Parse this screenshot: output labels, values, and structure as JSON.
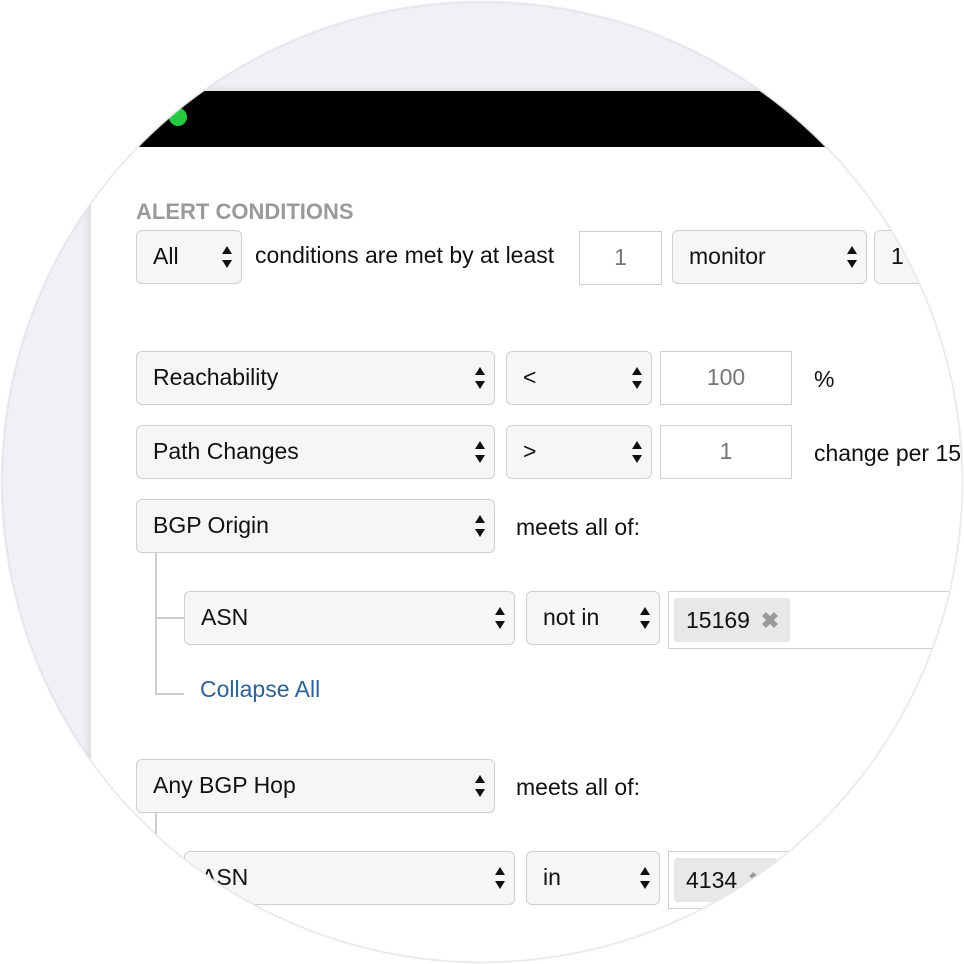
{
  "window": {
    "traffic_lights": [
      {
        "name": "close",
        "color": "#ff5f57"
      },
      {
        "name": "minimize",
        "color": "#febc2e"
      },
      {
        "name": "maximize",
        "color": "#28c840"
      }
    ]
  },
  "alert": {
    "heading": "ALERT CONDITIONS",
    "match_select": "All",
    "conditions_text": "conditions are met by at least",
    "count_input": "1",
    "entity_select": "monitor",
    "trailing_select": "1"
  },
  "conditions": {
    "reachability": {
      "metric": "Reachability",
      "operator": "<",
      "value": "100",
      "unit": "%"
    },
    "path_changes": {
      "metric": "Path Changes",
      "operator": ">",
      "value": "1",
      "unit": "change per 15"
    },
    "bgp_origin": {
      "metric": "BGP Origin",
      "meets": "meets all of:",
      "sub": {
        "field": "ASN",
        "operator": "not in",
        "tags": [
          "15169"
        ]
      },
      "collapse": "Collapse All"
    },
    "any_bgp_hop": {
      "metric": "Any BGP Hop",
      "meets": "meets all of:",
      "sub": {
        "field": "ASN",
        "operator": "in",
        "tags": [
          "4134"
        ]
      }
    }
  },
  "icons": {
    "select_arrows": "up-down-arrows-icon",
    "tag_remove": "remove-x-icon"
  }
}
